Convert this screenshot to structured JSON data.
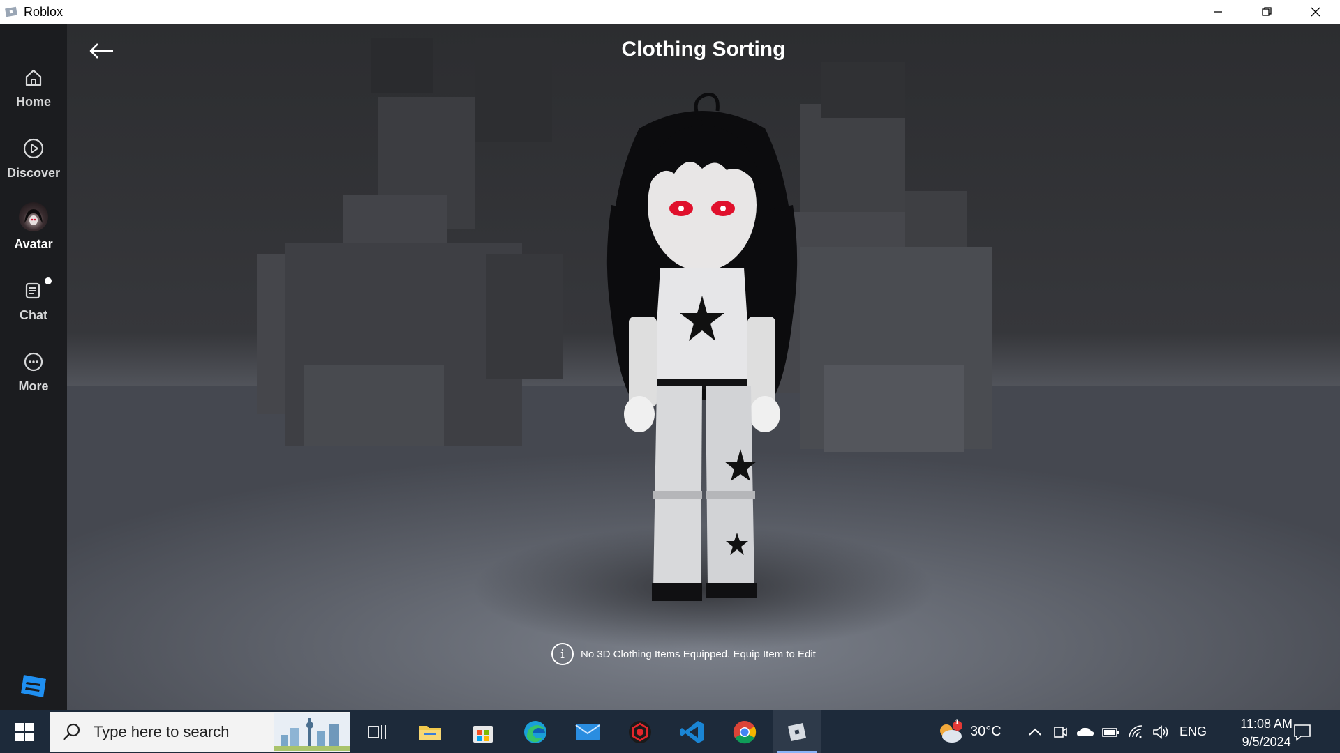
{
  "window": {
    "title": "Roblox"
  },
  "sidebar": {
    "items": [
      {
        "label": "Home",
        "icon": "home-icon"
      },
      {
        "label": "Discover",
        "icon": "play-circle-icon"
      },
      {
        "label": "Avatar",
        "icon": "avatar-thumbnail"
      },
      {
        "label": "Chat",
        "icon": "chat-icon"
      },
      {
        "label": "More",
        "icon": "more-icon"
      }
    ],
    "active": "Avatar"
  },
  "main": {
    "title": "Clothing Sorting",
    "info_message": "No 3D Clothing Items Equipped. Equip Item to Edit"
  },
  "taskbar": {
    "search_placeholder": "Type here to search",
    "weather": {
      "temp": "30°C",
      "badge": "1"
    },
    "language": "ENG",
    "time": "11:08 AM",
    "date": "9/5/2024"
  },
  "colors": {
    "sidebar_bg": "#1b1c1f",
    "taskbar_bg": "#1d2a3a",
    "accent_blue": "#1f8ff1"
  }
}
